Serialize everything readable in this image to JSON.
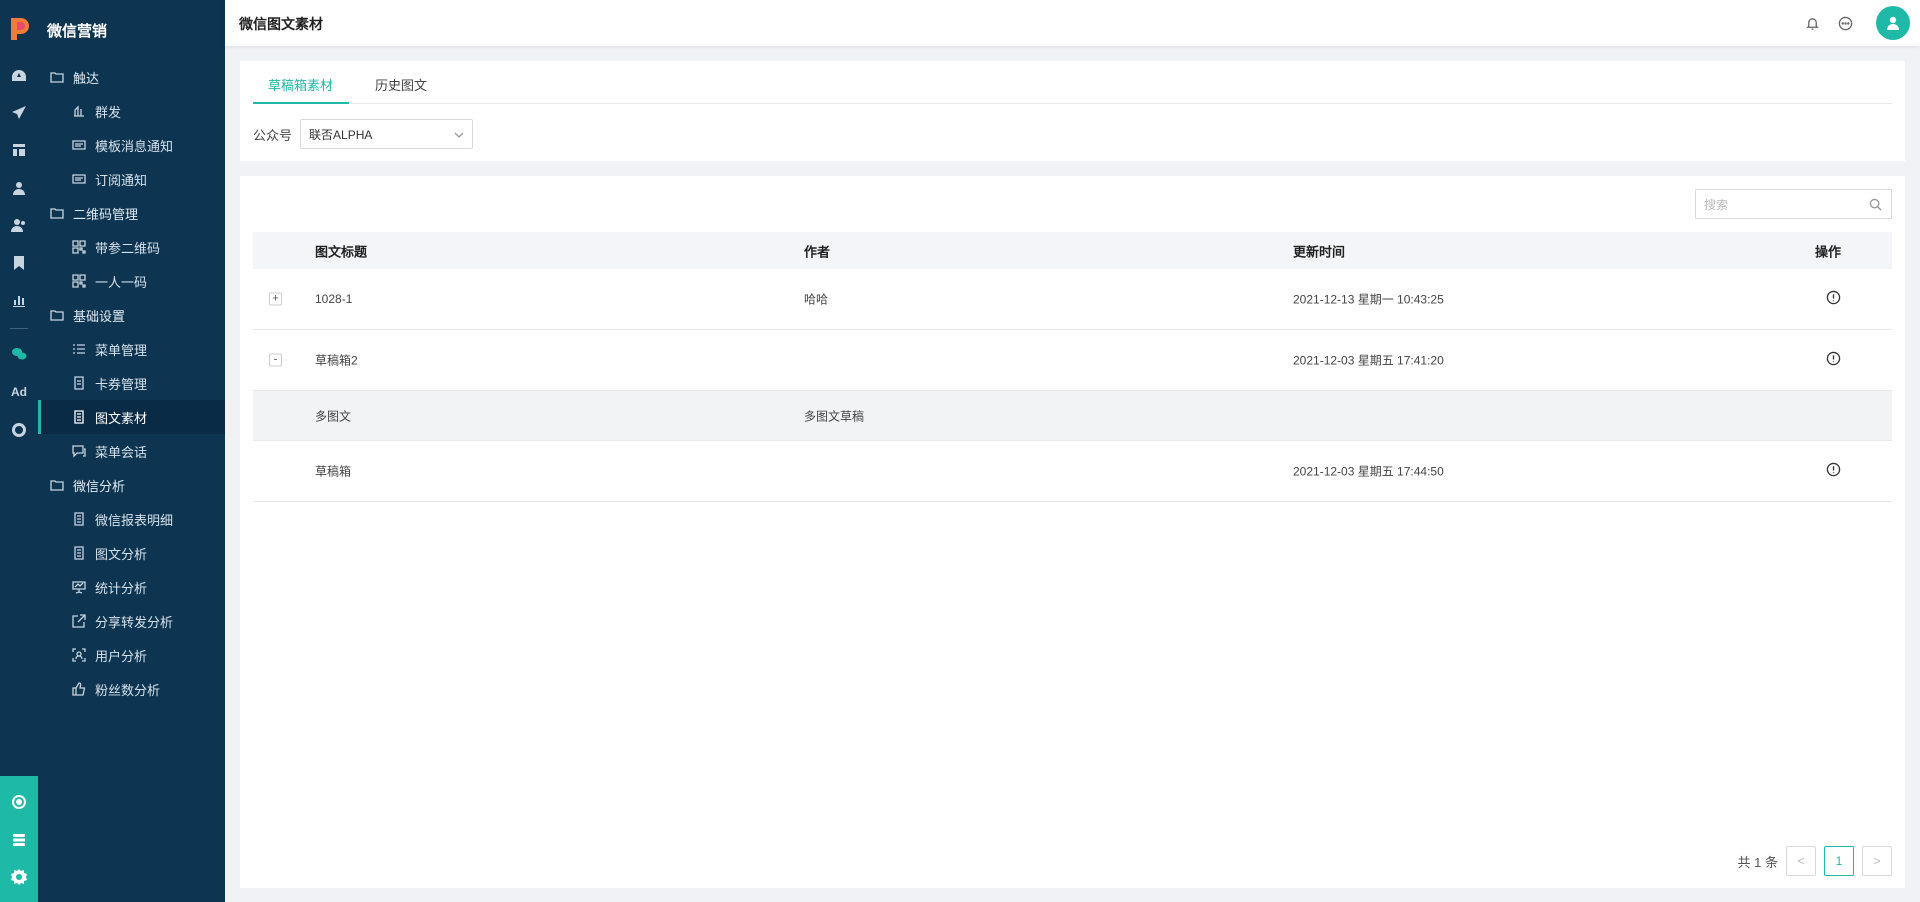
{
  "app": {
    "brand": "微信营销",
    "page_title": "微信图文素材"
  },
  "colors": {
    "sidebar_bg": "#0d3552",
    "accent": "#1fb9a7"
  },
  "rail": {
    "icons": [
      "dashboard-icon",
      "send-icon",
      "layout-icon",
      "user-icon",
      "users-icon",
      "bookmark-icon",
      "bar-chart-icon",
      "wechat-icon",
      "ad-icon",
      "circle-icon"
    ],
    "ad_label": "Ad",
    "bottom_icons": [
      "hub-icon",
      "server-icon",
      "gear-icon"
    ]
  },
  "menu": {
    "groups": [
      {
        "label": "触达",
        "items": [
          {
            "label": "群发",
            "icon": "broadcast-icon"
          },
          {
            "label": "模板消息通知",
            "icon": "message-icon"
          },
          {
            "label": "订阅通知",
            "icon": "message-icon"
          }
        ]
      },
      {
        "label": "二维码管理",
        "items": [
          {
            "label": "带参二维码",
            "icon": "qrcode-icon"
          },
          {
            "label": "一人一码",
            "icon": "qrcode-icon"
          }
        ]
      },
      {
        "label": "基础设置",
        "items": [
          {
            "label": "菜单管理",
            "icon": "list-icon"
          },
          {
            "label": "卡券管理",
            "icon": "coupon-icon"
          },
          {
            "label": "图文素材",
            "icon": "document-icon",
            "active": true
          },
          {
            "label": "菜单会话",
            "icon": "chat-icon"
          }
        ]
      },
      {
        "label": "微信分析",
        "items": [
          {
            "label": "微信报表明细",
            "icon": "document-icon"
          },
          {
            "label": "图文分析",
            "icon": "document-icon"
          },
          {
            "label": "统计分析",
            "icon": "presentation-icon"
          },
          {
            "label": "分享转发分析",
            "icon": "share-icon"
          },
          {
            "label": "用户分析",
            "icon": "user-scan-icon"
          },
          {
            "label": "粉丝数分析",
            "icon": "thumbs-up-icon"
          }
        ]
      }
    ]
  },
  "header": {
    "icons": [
      "bell-icon",
      "chat-bubble-icon",
      "avatar-icon"
    ]
  },
  "tabs": [
    {
      "label": "草稿箱素材",
      "active": true
    },
    {
      "label": "历史图文"
    }
  ],
  "filter": {
    "label": "公众号",
    "value": "联否ALPHA"
  },
  "search": {
    "placeholder": "搜索"
  },
  "table": {
    "columns": [
      "图文标题",
      "作者",
      "更新时间",
      "操作"
    ],
    "rows": [
      {
        "expand": "+",
        "title": "1028-1",
        "author": "哈哈",
        "time": "2021-12-13 星期一 10:43:25",
        "op_icon": "info-icon"
      },
      {
        "expand": "-",
        "title": "草稿箱2",
        "author": "",
        "time": "2021-12-03 星期五 17:41:20",
        "op_icon": "info-icon"
      },
      {
        "sub": true,
        "title": "多图文",
        "author": "多图文草稿",
        "time": ""
      },
      {
        "title": "草稿箱",
        "author": "",
        "time": "2021-12-03 星期五 17:44:50",
        "op_icon": "info-icon"
      }
    ]
  },
  "pagination": {
    "total": "共 1 条",
    "prev": "<",
    "current": "1",
    "next": ">"
  }
}
